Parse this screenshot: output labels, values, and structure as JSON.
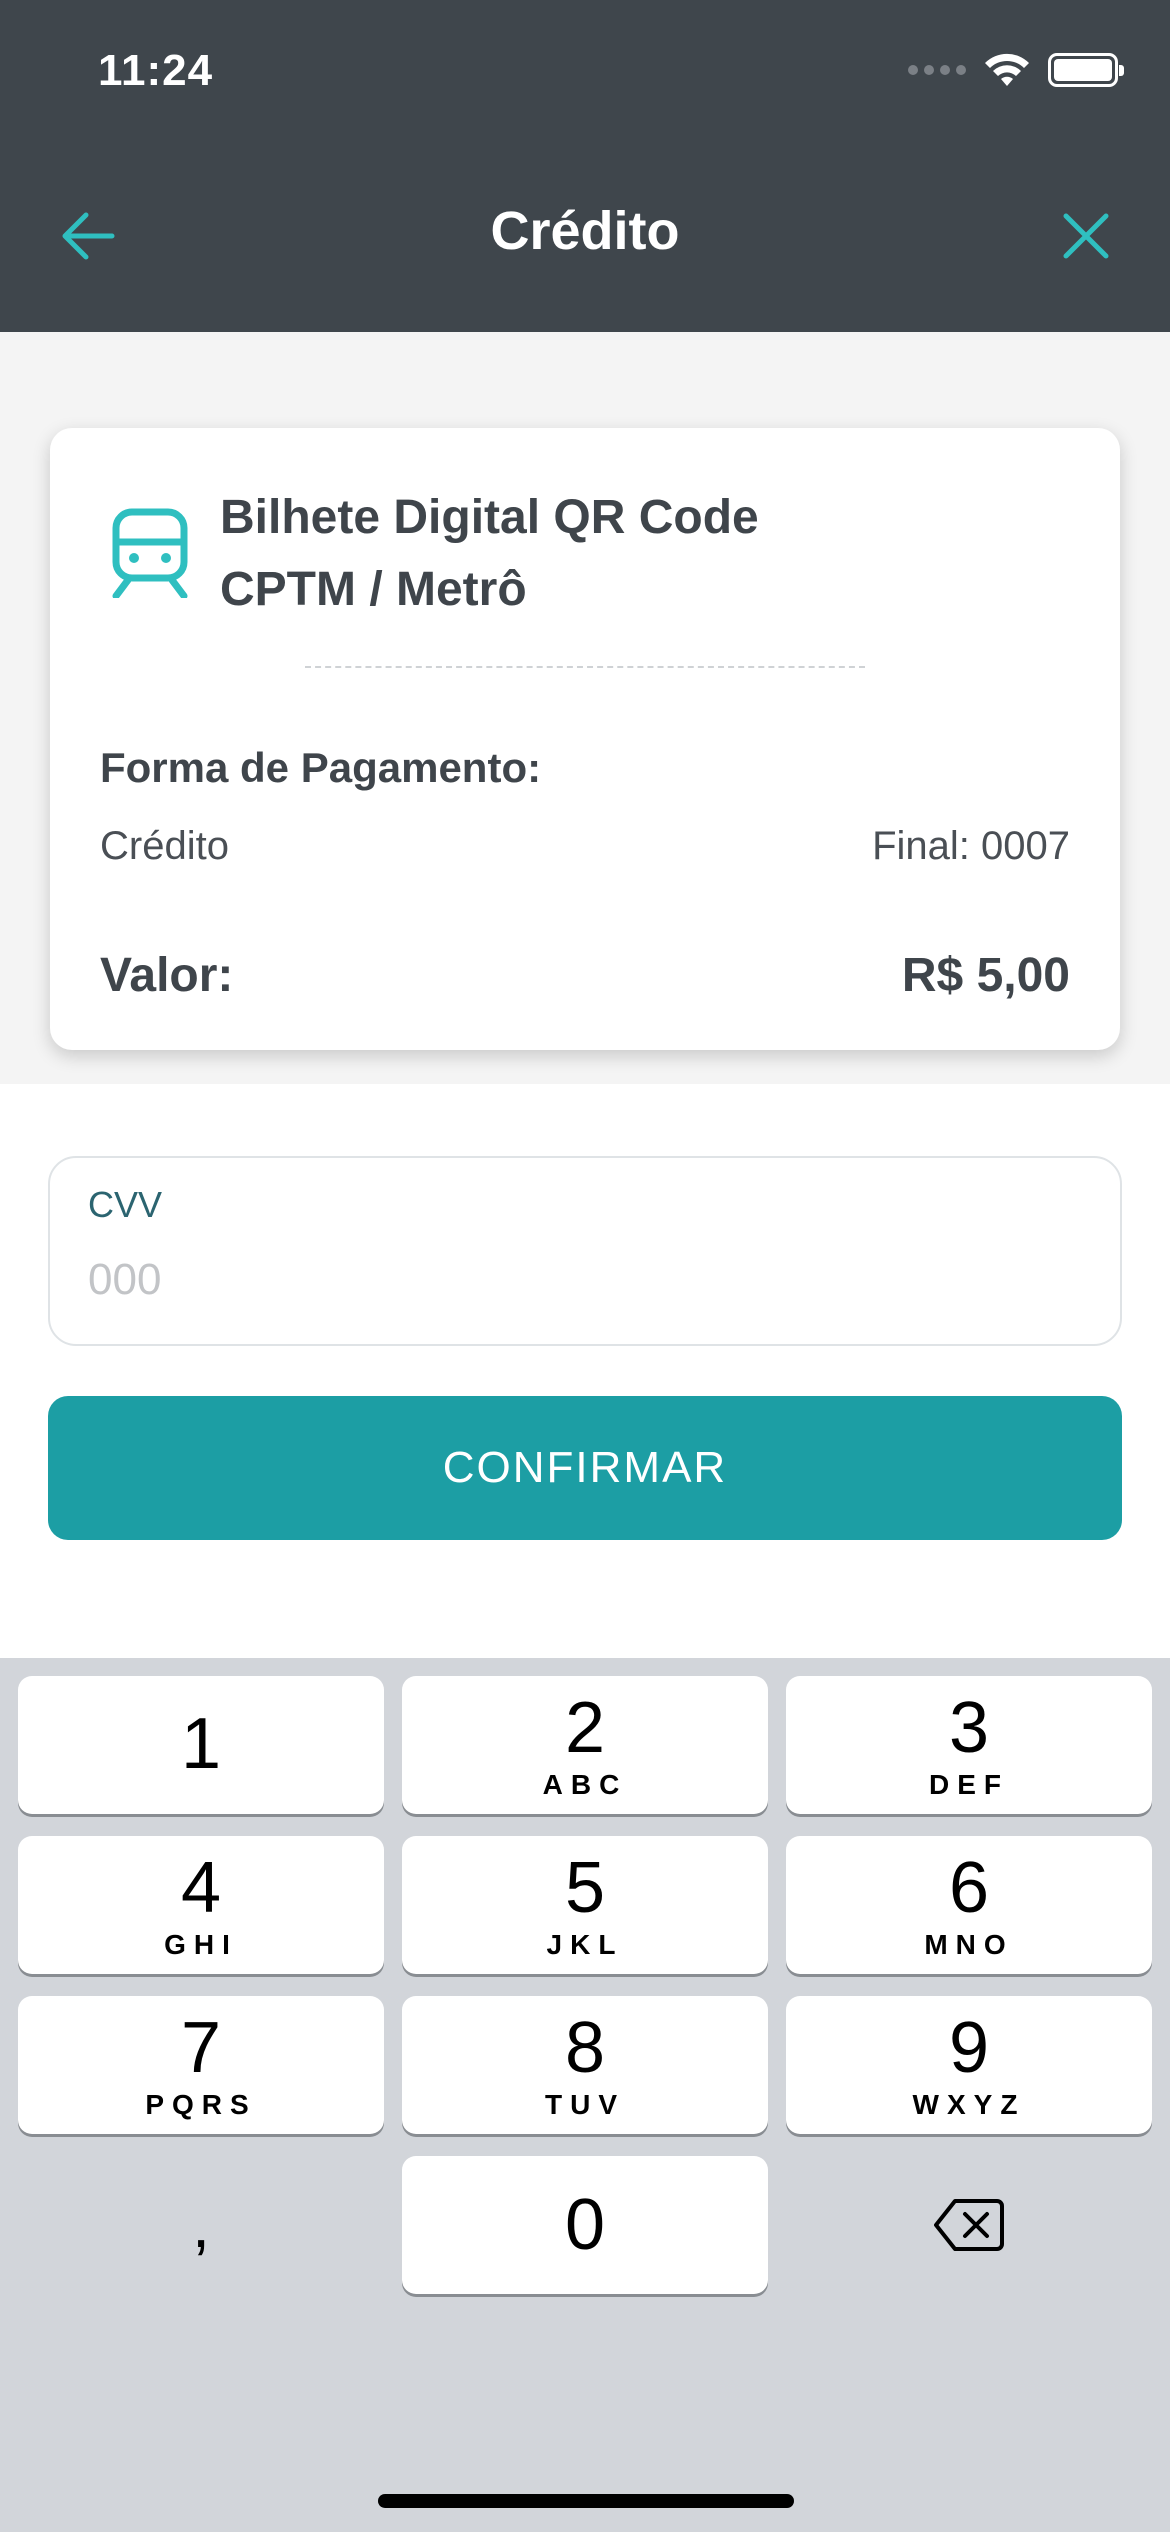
{
  "status_bar": {
    "time": "11:24"
  },
  "nav": {
    "title": "Crédito"
  },
  "card": {
    "ticket_title_line1": "Bilhete Digital QR Code",
    "ticket_title_line2": "CPTM / Metrô",
    "payment_label": "Forma de Pagamento:",
    "payment_method": "Crédito",
    "card_final": "Final: 0007",
    "value_label": "Valor:",
    "value_amount": "R$ 5,00"
  },
  "form": {
    "cvv_label": "CVV",
    "cvv_placeholder": "000",
    "cvv_value": "",
    "confirm_label": "CONFIRMAR"
  },
  "keyboard": {
    "keys": [
      {
        "digit": "1",
        "letters": ""
      },
      {
        "digit": "2",
        "letters": "ABC"
      },
      {
        "digit": "3",
        "letters": "DEF"
      },
      {
        "digit": "4",
        "letters": "GHI"
      },
      {
        "digit": "5",
        "letters": "JKL"
      },
      {
        "digit": "6",
        "letters": "MNO"
      },
      {
        "digit": "7",
        "letters": "PQRS"
      },
      {
        "digit": "8",
        "letters": "TUV"
      },
      {
        "digit": "9",
        "letters": "WXYZ"
      },
      {
        "digit": "0",
        "letters": ""
      }
    ],
    "comma": ","
  },
  "colors": {
    "header_bg": "#3f464c",
    "accent": "#1c9ea4",
    "icon_teal": "#2fbfc0"
  },
  "icons": [
    "back-arrow-icon",
    "close-icon",
    "train-icon",
    "backspace-icon",
    "wifi-icon",
    "battery-icon",
    "signal-icon"
  ]
}
